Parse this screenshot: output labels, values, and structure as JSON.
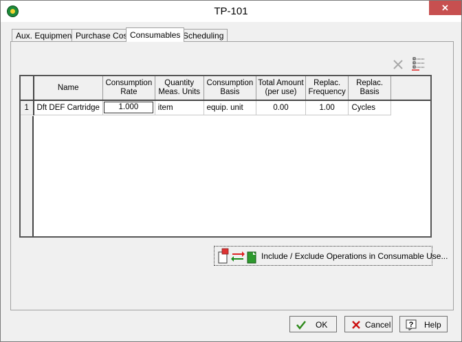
{
  "window": {
    "title": "TP-101",
    "close_glyph": "✕"
  },
  "tabs": [
    {
      "label": "Aux. Equipment",
      "active": false
    },
    {
      "label": "Purchase Cost",
      "active": false
    },
    {
      "label": "Consumables",
      "active": true
    },
    {
      "label": "Scheduling",
      "active": false
    }
  ],
  "toolbar": {
    "icons": [
      "delete-x-icon",
      "list-options-icon"
    ]
  },
  "table": {
    "headers": [
      {
        "line1": "Name",
        "line2": ""
      },
      {
        "line1": "Consumption",
        "line2": "Rate"
      },
      {
        "line1": "Quantity",
        "line2": "Meas. Units"
      },
      {
        "line1": "Consumption",
        "line2": "Basis"
      },
      {
        "line1": "Total Amount",
        "line2": "(per use)"
      },
      {
        "line1": "Replac.",
        "line2": "Frequency"
      },
      {
        "line1": "Replac.",
        "line2": "Basis"
      }
    ],
    "rows": [
      {
        "row_number": "1",
        "name": "Dft DEF Cartridge",
        "consumption_rate": "1.000",
        "quantity_units": "item",
        "consumption_basis": "equip. unit",
        "total_amount": "0.00",
        "replac_frequency": "1.00",
        "replac_basis": "Cycles"
      }
    ]
  },
  "include_button": {
    "label": "Include / Exclude Operations in Consumable Use..."
  },
  "footer": {
    "ok_label": "OK",
    "cancel_label": "Cancel",
    "help_label": "Help"
  },
  "colors": {
    "title_close": "#c75050",
    "ok_check": "#2f8a1c",
    "cancel_x": "#cc1111"
  }
}
